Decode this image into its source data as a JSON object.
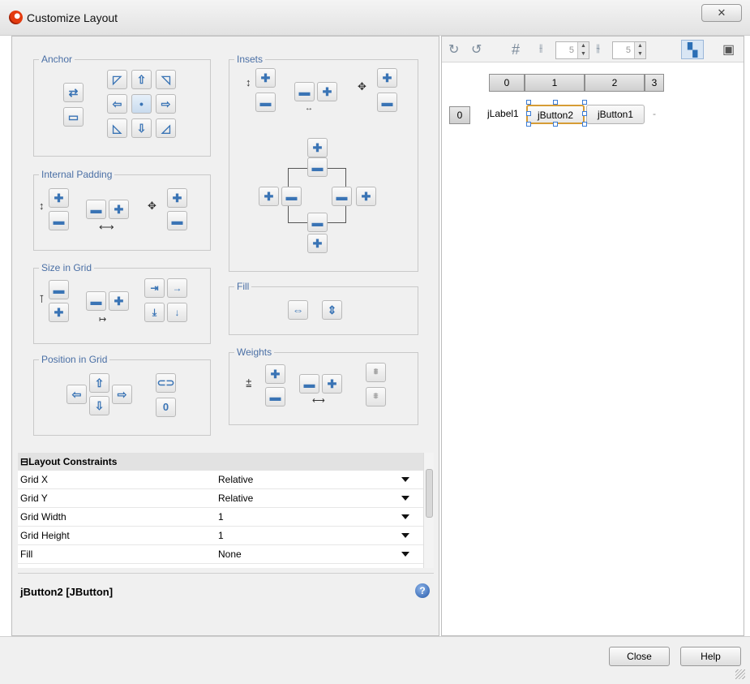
{
  "window": {
    "title": "Customize Layout",
    "close_symbol": "✕"
  },
  "anchor": {
    "label": "Anchor"
  },
  "insets": {
    "label": "Insets"
  },
  "internal_padding": {
    "label": "Internal Padding"
  },
  "size_in_grid": {
    "label": "Size in Grid"
  },
  "fill": {
    "label": "Fill"
  },
  "position_in_grid": {
    "label": "Position in Grid"
  },
  "weights": {
    "label": "Weights"
  },
  "layout_constraints": {
    "header": "Layout Constraints",
    "rows": [
      {
        "name": "Grid X",
        "value": "Relative"
      },
      {
        "name": "Grid Y",
        "value": "Relative"
      },
      {
        "name": "Grid Width",
        "value": "1"
      },
      {
        "name": "Grid Height",
        "value": "1"
      },
      {
        "name": "Fill",
        "value": "None"
      }
    ]
  },
  "selection": {
    "title": "jButton2 [JButton]",
    "help_symbol": "?"
  },
  "toolbar": {
    "hgap_value": "5",
    "vgap_value": "5"
  },
  "grid": {
    "columns": [
      "0",
      "1",
      "2",
      "3"
    ],
    "rows": [
      "0"
    ],
    "cells": [
      "jLabel1",
      "jButton2",
      "jButton1",
      "-"
    ]
  },
  "footer": {
    "close_label": "Close",
    "help_label": "Help"
  },
  "colors": {
    "group_label": "#4a6fa5",
    "button_icon": "#3a74b5",
    "selection_border": "#d69c35"
  }
}
